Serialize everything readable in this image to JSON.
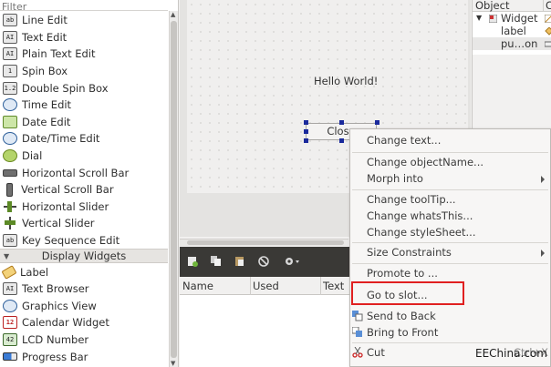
{
  "filter": {
    "placeholder": "Filter"
  },
  "widget_box": {
    "items": [
      {
        "label": "Line Edit",
        "icon": "line-edit-icon",
        "glyph": "ab"
      },
      {
        "label": "Text Edit",
        "icon": "text-edit-icon",
        "glyph": "AI"
      },
      {
        "label": "Plain Text Edit",
        "icon": "plain-text-edit-icon",
        "glyph": "AI"
      },
      {
        "label": "Spin Box",
        "icon": "spin-box-icon",
        "glyph": "1"
      },
      {
        "label": "Double Spin Box",
        "icon": "double-spin-box-icon",
        "glyph": "1.2"
      },
      {
        "label": "Time Edit",
        "icon": "clock-icon",
        "glyph": ""
      },
      {
        "label": "Date Edit",
        "icon": "calendar-icon",
        "glyph": ""
      },
      {
        "label": "Date/Time Edit",
        "icon": "datetime-icon",
        "glyph": ""
      },
      {
        "label": "Dial",
        "icon": "dial-icon",
        "glyph": ""
      },
      {
        "label": "Horizontal Scroll Bar",
        "icon": "horizontal-scrollbar-icon",
        "glyph": ""
      },
      {
        "label": "Vertical Scroll Bar",
        "icon": "vertical-scrollbar-icon",
        "glyph": ""
      },
      {
        "label": "Horizontal Slider",
        "icon": "horizontal-slider-icon",
        "glyph": ""
      },
      {
        "label": "Vertical Slider",
        "icon": "vertical-slider-icon",
        "glyph": ""
      },
      {
        "label": "Key Sequence Edit",
        "icon": "key-sequence-icon",
        "glyph": "ab"
      }
    ],
    "category": "Display Widgets",
    "display_items": [
      {
        "label": "Label",
        "icon": "label-tag-icon",
        "glyph": ""
      },
      {
        "label": "Text Browser",
        "icon": "text-browser-icon",
        "glyph": "AI"
      },
      {
        "label": "Graphics View",
        "icon": "graphics-view-icon",
        "glyph": ""
      },
      {
        "label": "Calendar Widget",
        "icon": "calendar-widget-icon",
        "glyph": "12"
      },
      {
        "label": "LCD Number",
        "icon": "lcd-number-icon",
        "glyph": "42"
      },
      {
        "label": "Progress Bar",
        "icon": "progress-bar-icon",
        "glyph": ""
      }
    ]
  },
  "form": {
    "label_text": "Hello World!",
    "button_text": "Close"
  },
  "signal_slot_editor": {
    "columns": [
      "Name",
      "Used",
      "Text"
    ]
  },
  "object_inspector": {
    "headers": [
      "Object",
      "C"
    ],
    "rows": [
      {
        "name": "Widget",
        "expander": "▼"
      },
      {
        "name": "label"
      },
      {
        "name": "pu…on"
      }
    ]
  },
  "context_menu": {
    "items": [
      {
        "label": "Change text...",
        "submenu": false
      },
      {
        "label": "Change objectName...",
        "submenu": false
      },
      {
        "label": "Morph into",
        "submenu": true
      },
      {
        "label": "Change toolTip...",
        "submenu": false
      },
      {
        "label": "Change whatsThis...",
        "submenu": false
      },
      {
        "label": "Change styleSheet...",
        "submenu": false
      },
      {
        "label": "Size Constraints",
        "submenu": true
      },
      {
        "label": "Promote to ...",
        "submenu": false
      },
      {
        "label": "Go to slot...",
        "submenu": false,
        "highlighted": true
      },
      {
        "label": "Send to Back",
        "icon": "send-to-back-icon"
      },
      {
        "label": "Bring to Front",
        "icon": "bring-to-front-icon"
      },
      {
        "label": "Cut",
        "icon": "scissors-icon",
        "shortcut": "Ctrl+X"
      }
    ]
  },
  "watermark": "EEChina.com",
  "colors": {
    "handle": "#1a2a9c",
    "highlight_box": "#e02020",
    "toolbar_bg": "#3a3936"
  }
}
